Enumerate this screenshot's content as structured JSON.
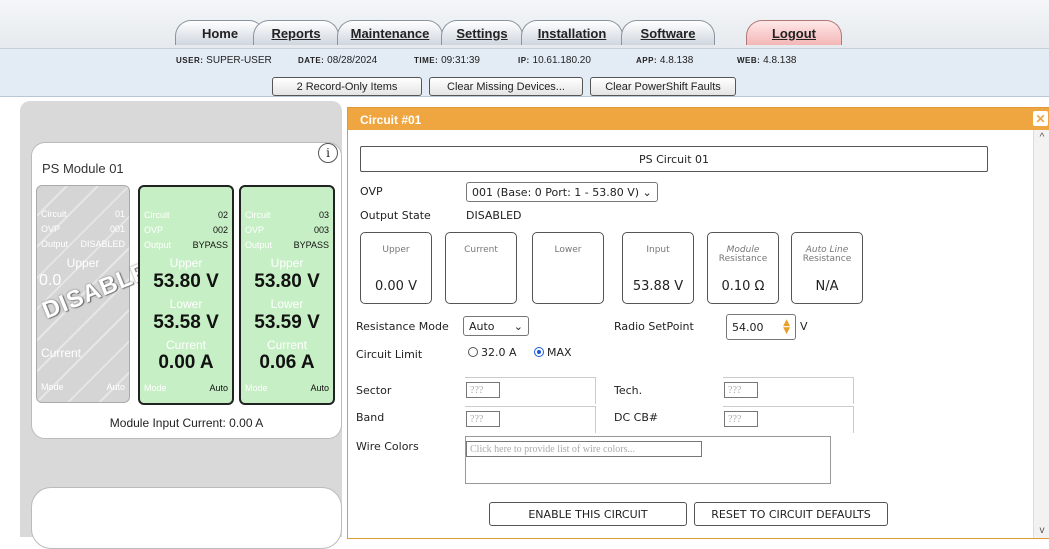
{
  "nav": {
    "tabs": [
      {
        "label": "Home"
      },
      {
        "label": "Reports"
      },
      {
        "label": "Maintenance"
      },
      {
        "label": "Settings"
      },
      {
        "label": "Installation"
      },
      {
        "label": "Software"
      },
      {
        "label": "Logout"
      }
    ]
  },
  "info": {
    "user_label": "USER:",
    "user": "SUPER-USER",
    "date_label": "DATE:",
    "date": "08/28/2024",
    "time_label": "TIME:",
    "time": "09:31:39",
    "ip_label": "IP:",
    "ip": "10.61.180.20",
    "app_label": "APP:",
    "app": "4.8.138",
    "web_label": "WEB:",
    "web": "4.8.138"
  },
  "actions": {
    "record_only": "2 Record-Only Items",
    "clear_missing": "Clear Missing Devices...",
    "clear_powershift": "Clear PowerShift Faults"
  },
  "module": {
    "title": "PS Module 01",
    "input_current": "Module Input Current: 0.00 A",
    "disabled_word": "DISABLED",
    "cards": [
      {
        "circuit_label": "Circuit",
        "circuit": "01",
        "ovp_label": "OVP",
        "ovp": "001",
        "output_label": "Output",
        "output": "DISABLED",
        "upper_label": "Upper",
        "upper": "0.0",
        "lower_label": "Lower",
        "lower": "",
        "current_label": "Current",
        "current": "",
        "mode_label": "Mode",
        "mode": "Auto"
      },
      {
        "circuit_label": "Circuit",
        "circuit": "02",
        "ovp_label": "OVP",
        "ovp": "002",
        "output_label": "Output",
        "output": "BYPASS",
        "upper_label": "Upper",
        "upper": "53.80 V",
        "lower_label": "Lower",
        "lower": "53.58 V",
        "current_label": "Current",
        "current": "0.00 A",
        "mode_label": "Mode",
        "mode": "Auto"
      },
      {
        "circuit_label": "Circuit",
        "circuit": "03",
        "ovp_label": "OVP",
        "ovp": "003",
        "output_label": "Output",
        "output": "BYPASS",
        "upper_label": "Upper",
        "upper": "53.80 V",
        "lower_label": "Lower",
        "lower": "53.59 V",
        "current_label": "Current",
        "current": "0.06 A",
        "mode_label": "Mode",
        "mode": "Auto"
      }
    ]
  },
  "dialog": {
    "title": "Circuit #01",
    "name": "PS Circuit 01",
    "ovp_label": "OVP",
    "ovp_value": "001 (Base: 0 Port: 1 - 53.80 V) ⌄",
    "output_state_label": "Output State",
    "output_state": "DISABLED",
    "measures": [
      {
        "label": "Upper",
        "label2": "",
        "value": "0.00 V"
      },
      {
        "label": "Current",
        "label2": "",
        "value": ""
      },
      {
        "label": "Lower",
        "label2": "",
        "value": ""
      },
      {
        "label": "Input",
        "label2": "",
        "value": "53.88 V"
      },
      {
        "label": "Module",
        "label2": "Resistance",
        "value": "0.10 Ω"
      },
      {
        "label": "Auto Line",
        "label2": "Resistance",
        "value": "N/A"
      }
    ],
    "resistance_mode_label": "Resistance Mode",
    "resistance_mode": "Auto",
    "radio_setpoint_label": "Radio SetPoint",
    "radio_setpoint": "54.00",
    "radio_setpoint_unit": "V",
    "circuit_limit_label": "Circuit Limit",
    "limit_option1": "32.0 A",
    "limit_option2": "MAX",
    "sector_label": "Sector",
    "sector": "???",
    "tech_label": "Tech.",
    "tech": "???",
    "band_label": "Band",
    "band": "???",
    "dccb_label": "DC CB#",
    "dccb": "???",
    "wire_colors_label": "Wire Colors",
    "wire_colors_placeholder": "Click here to provide list of wire colors...",
    "enable_button": "ENABLE THIS CIRCUIT",
    "reset_button": "RESET TO CIRCUIT DEFAULTS"
  }
}
